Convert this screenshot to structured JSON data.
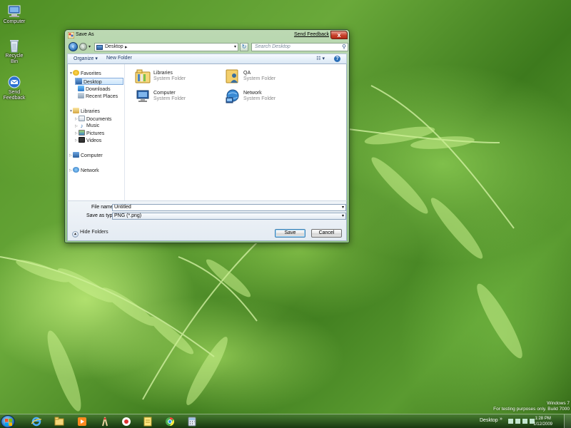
{
  "desktop": {
    "icons": [
      {
        "label": "Computer",
        "icon": "computer-icon"
      },
      {
        "label": "Recycle Bin",
        "icon": "recycle-bin-icon"
      },
      {
        "label": "Send\nFeedback",
        "icon": "send-feedback-icon"
      }
    ],
    "watermark": {
      "line1": "Windows 7",
      "line2": "For testing purposes only. Build 7000"
    }
  },
  "dialog": {
    "title": "Save As",
    "send_feedback": "Send Feedback",
    "close_label": "x",
    "address": {
      "crumb": "Desktop",
      "arrow": "▸"
    },
    "search_placeholder": "Search Desktop",
    "toolbar": {
      "organize": "Organize ▾",
      "new_folder": "New Folder",
      "views": "☷ ▾",
      "help": "?"
    },
    "nav": {
      "favorites": "Favorites",
      "desktop": "Desktop",
      "downloads": "Downloads",
      "recent_places": "Recent Places",
      "libraries": "Libraries",
      "documents": "Documents",
      "music": "Music",
      "pictures": "Pictures",
      "videos": "Videos",
      "computer": "Computer",
      "network": "Network"
    },
    "items": [
      {
        "name": "Libraries",
        "type": "System Folder",
        "icon": "libraries-icon"
      },
      {
        "name": "QA",
        "type": "System Folder",
        "icon": "user-folder-icon"
      },
      {
        "name": "Computer",
        "type": "System Folder",
        "icon": "computer-icon"
      },
      {
        "name": "Network",
        "type": "System Folder",
        "icon": "network-icon"
      }
    ],
    "file_name_label": "File name:",
    "file_name_value": "Untitled",
    "save_type_label": "Save as type:",
    "save_type_value": "PNG (*.png)",
    "hide_folders": "Hide Folders",
    "save_button": "Save",
    "cancel_button": "Cancel"
  },
  "taskbar": {
    "apps": [
      "internet-explorer-icon",
      "windows-explorer-icon",
      "media-player-icon",
      "paint-icon",
      "feedback-tool-icon",
      "notepad-icon",
      "chrome-icon",
      "calculator-icon"
    ],
    "desktop_label": "Desktop",
    "chevron": "»",
    "time": "1:28 PM",
    "date": "1/12/2009"
  },
  "colors": {
    "accent_blue": "#2a6fb8",
    "close_red": "#c8412c",
    "window_frame": "#8fbf82"
  }
}
